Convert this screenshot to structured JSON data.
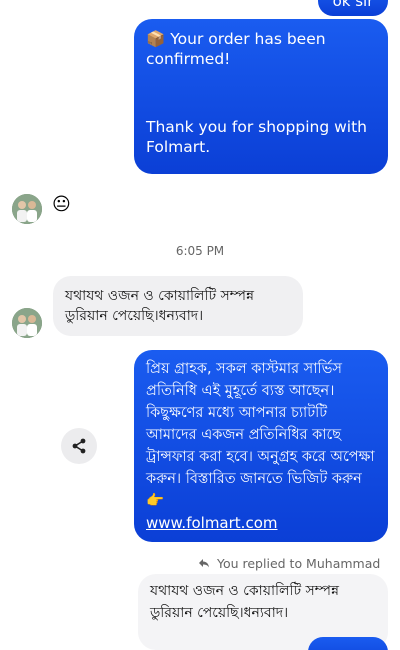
{
  "conversation": {
    "top_message": "ok sir",
    "order_message": {
      "line1": "📦 Your order has been confirmed!",
      "line2": "Thank you for shopping with Folmart."
    },
    "reaction_emoji": "😐",
    "time_divider": "6:05 PM",
    "customer_message": "যথাযথ ওজন ও কোয়ালিটি সম্পন্ন ডুরিয়ান পেয়েছি।ধন্যবাদ।",
    "auto_reply": {
      "text": "প্রিয় গ্রাহক, সকল কাস্টমার সার্ভিস প্রতিনিধি এই মুহূর্তে ব্যস্ত আছেন। কিছুক্ষণের মধ্যে আপনার চ্যাটটি আমাদের একজন প্রতিনিধির কাছে ট্রান্সফার করা হবে। অনুগ্রহ করে অপেক্ষা করুন। বিস্তারিত জানতে ভিজিট করুন 👉",
      "link": "www.folmart.com"
    },
    "reply_note": "You replied to Muhammad",
    "quoted_message": "যথাযথ ওজন ও কোয়ালিটি সম্পন্ন ডুরিয়ান পেয়েছি।ধন্যবাদ।"
  },
  "icons": {
    "share": "share-icon",
    "reply": "reply-arrow-icon"
  },
  "colors": {
    "outgoing_bubble": "#1a5cf0",
    "incoming_bubble": "#f0f0f2",
    "muted_text": "#666666"
  }
}
